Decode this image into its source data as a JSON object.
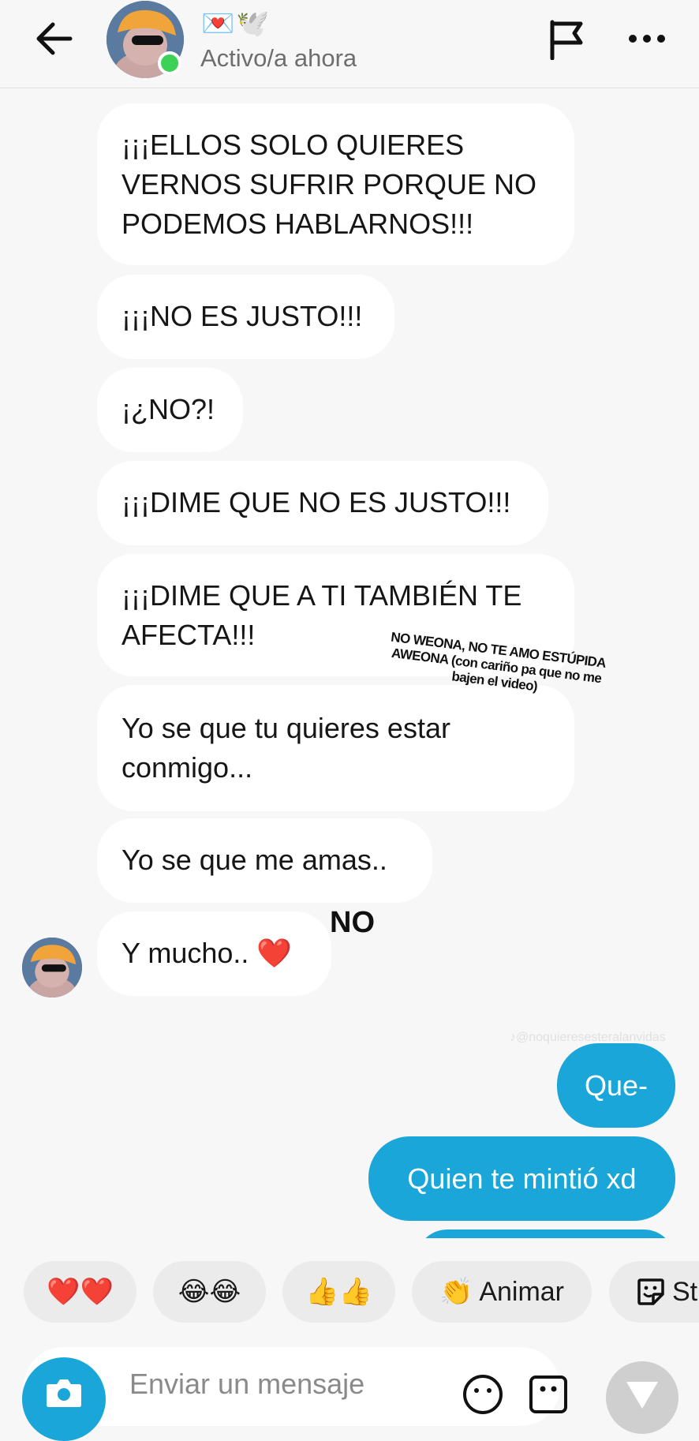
{
  "header": {
    "name_emojis": [
      "💌",
      "🕊️"
    ],
    "status": "Activo/a ahora",
    "back_icon": "arrow-left-icon",
    "flag_icon": "flag-icon",
    "more_icon": "more-horizontal-icon"
  },
  "messages_received": [
    {
      "lines": [
        "¡¡¡ELLOS SOLO QUIERES",
        "VERNOS SUFRIR PORQUE NO",
        "PODEMOS HABLARNOS!!!"
      ]
    },
    {
      "lines": [
        "¡¡¡NO ES JUSTO!!!"
      ]
    },
    {
      "lines": [
        "¡¿NO?!"
      ]
    },
    {
      "lines": [
        "¡¡¡DIME QUE NO ES JUSTO!!!"
      ]
    },
    {
      "lines": [
        "¡¡¡DIME QUE A TI TAMBIÉN TE",
        "AFECTA!!!"
      ]
    },
    {
      "lines": [
        "Yo se que tu quieres estar",
        "conmigo..."
      ]
    },
    {
      "lines": [
        "Yo se que me amas.."
      ]
    },
    {
      "lines": [
        "Y mucho.. ❤️"
      ]
    }
  ],
  "messages_sent": [
    {
      "text": "Que-"
    },
    {
      "text": "Quien te mintió xd"
    }
  ],
  "overlay": {
    "note": "NO WEONA, NO TE AMO ESTÚPIDA AWEONA (con cariño pa que no me bajen el video)",
    "no": "NO",
    "watermark": "♪@noquieresesteralanvidas"
  },
  "quick_reactions": [
    {
      "label": "❤️❤️"
    },
    {
      "label": "😂😂"
    },
    {
      "label": "👍👍"
    },
    {
      "emoji": "👏",
      "label": "Animar"
    },
    {
      "label": "St"
    }
  ],
  "composer": {
    "placeholder": "Enviar un mensaje",
    "camera_icon": "camera-icon",
    "emoji_icon": "emoji-icon",
    "sticker_icon": "sticker-icon",
    "send_icon": "send-icon"
  },
  "colors": {
    "sent_bubble": "#1aa6d8",
    "received_bubble": "#ffffff",
    "background": "#f7f7f7",
    "online": "#3ed158"
  }
}
